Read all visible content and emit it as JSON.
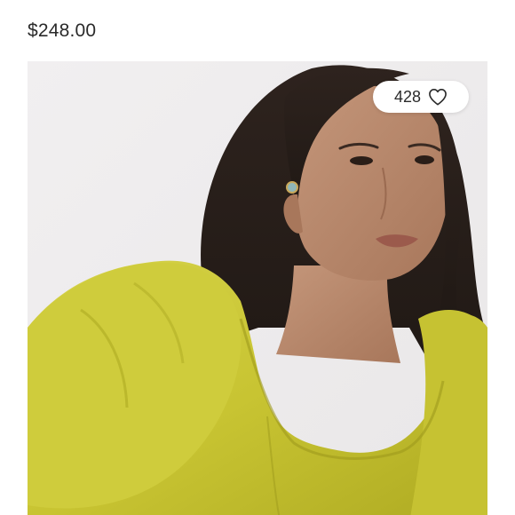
{
  "product": {
    "price": "$248.00"
  },
  "likes": {
    "count": "428",
    "icon": "heart-outline-icon"
  },
  "image": {
    "subject": "product-photo",
    "colors": {
      "background": "#efedee",
      "garment": "#c9c63a",
      "skin": "#b98a6a",
      "hair": "#2b211c"
    }
  }
}
